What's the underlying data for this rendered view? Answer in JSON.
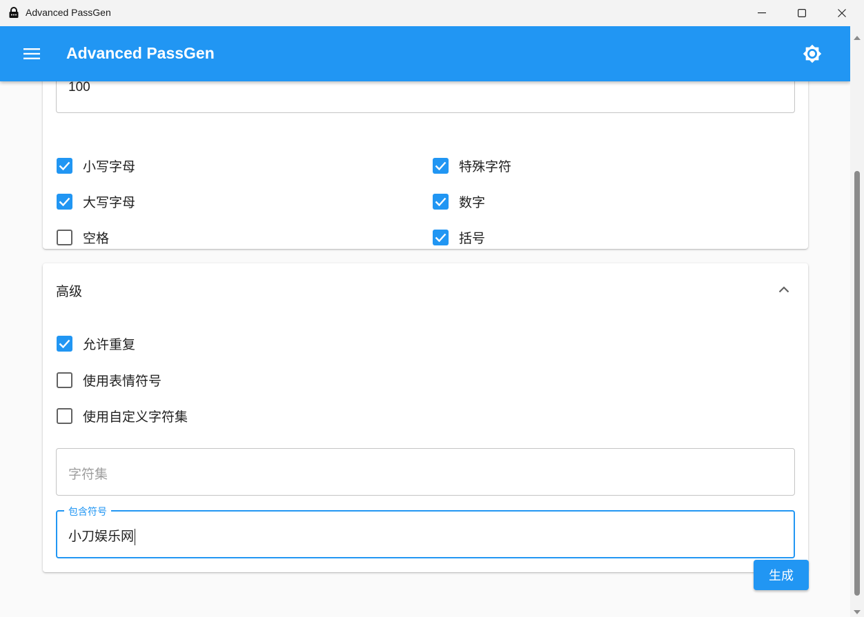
{
  "window": {
    "title": "Advanced PassGen",
    "icon": "lock-icon"
  },
  "appbar": {
    "title": "Advanced PassGen",
    "menu_icon": "hamburger-menu-icon",
    "theme_icon": "brightness-icon",
    "color": "#2196f3"
  },
  "options": {
    "length_value": "100",
    "checkboxes": [
      {
        "label": "小写字母",
        "checked": true
      },
      {
        "label": "特殊字符",
        "checked": true
      },
      {
        "label": "大写字母",
        "checked": true
      },
      {
        "label": "数字",
        "checked": true
      },
      {
        "label": "空格",
        "checked": false
      },
      {
        "label": "括号",
        "checked": true
      }
    ]
  },
  "advanced": {
    "header": "高级",
    "expanded": true,
    "checkboxes": [
      {
        "label": "允许重复",
        "checked": true
      },
      {
        "label": "使用表情符号",
        "checked": false
      },
      {
        "label": "使用自定义字符集",
        "checked": false
      }
    ],
    "charset_placeholder": "字符集",
    "include_label": "包含符号",
    "include_value": "小刀娱乐网"
  },
  "generate_label": "生成"
}
